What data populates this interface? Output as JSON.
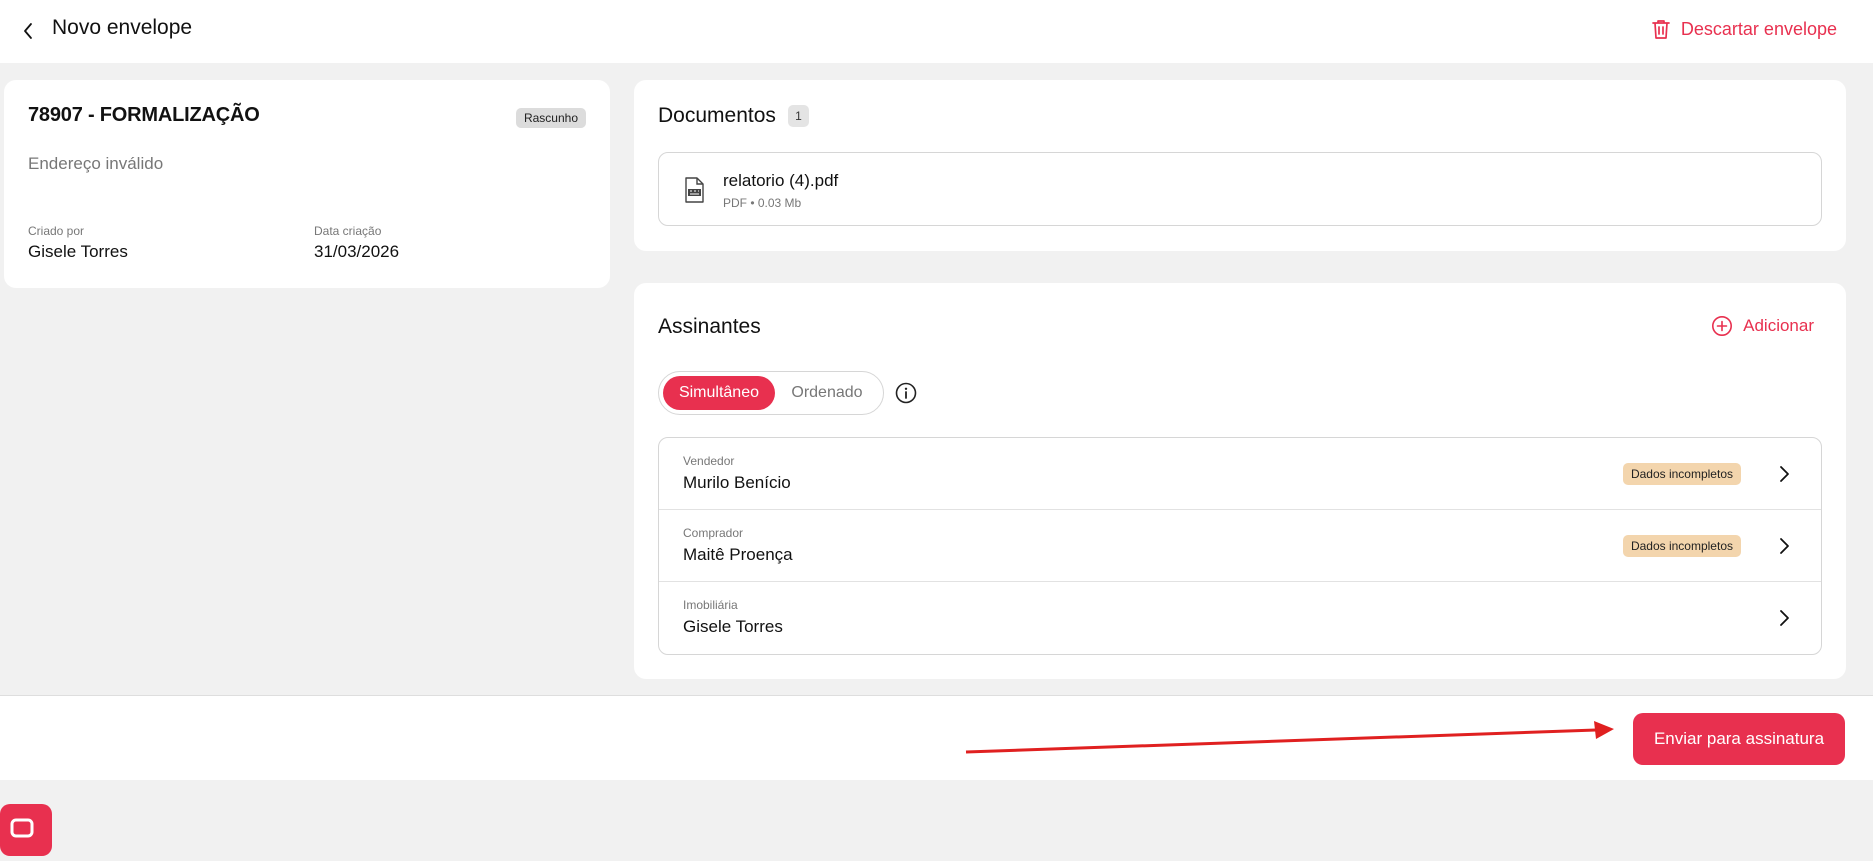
{
  "header": {
    "title": "Novo envelope",
    "discard_label": "Descartar envelope"
  },
  "envelope": {
    "title": "78907 - FORMALIZAÇÃO",
    "status": "Rascunho",
    "subtitle": "Endereço inválido",
    "created_by_label": "Criado por",
    "created_by": "Gisele Torres",
    "created_date_label": "Data criação",
    "created_date": "31/03/2026"
  },
  "documents": {
    "title": "Documentos",
    "count": "1",
    "files": [
      {
        "name": "relatorio (4).pdf",
        "meta": "PDF • 0.03 Mb"
      }
    ]
  },
  "signers": {
    "title": "Assinantes",
    "add_label": "Adicionar",
    "mode_options": [
      "Simultâneo",
      "Ordenado"
    ],
    "selected_mode": "Simultâneo",
    "list": [
      {
        "role": "Vendedor",
        "name": "Murilo Benício",
        "badge": "Dados incompletos"
      },
      {
        "role": "Comprador",
        "name": "Maitê Proença",
        "badge": "Dados incompletos"
      },
      {
        "role": "Imobiliária",
        "name": "Gisele Torres",
        "badge": ""
      }
    ]
  },
  "footer": {
    "send_label": "Enviar para assinatura"
  },
  "colors": {
    "accent": "#e8304f",
    "warning_badge": "#f3d5ad",
    "annotation_arrow": "#e02020"
  }
}
